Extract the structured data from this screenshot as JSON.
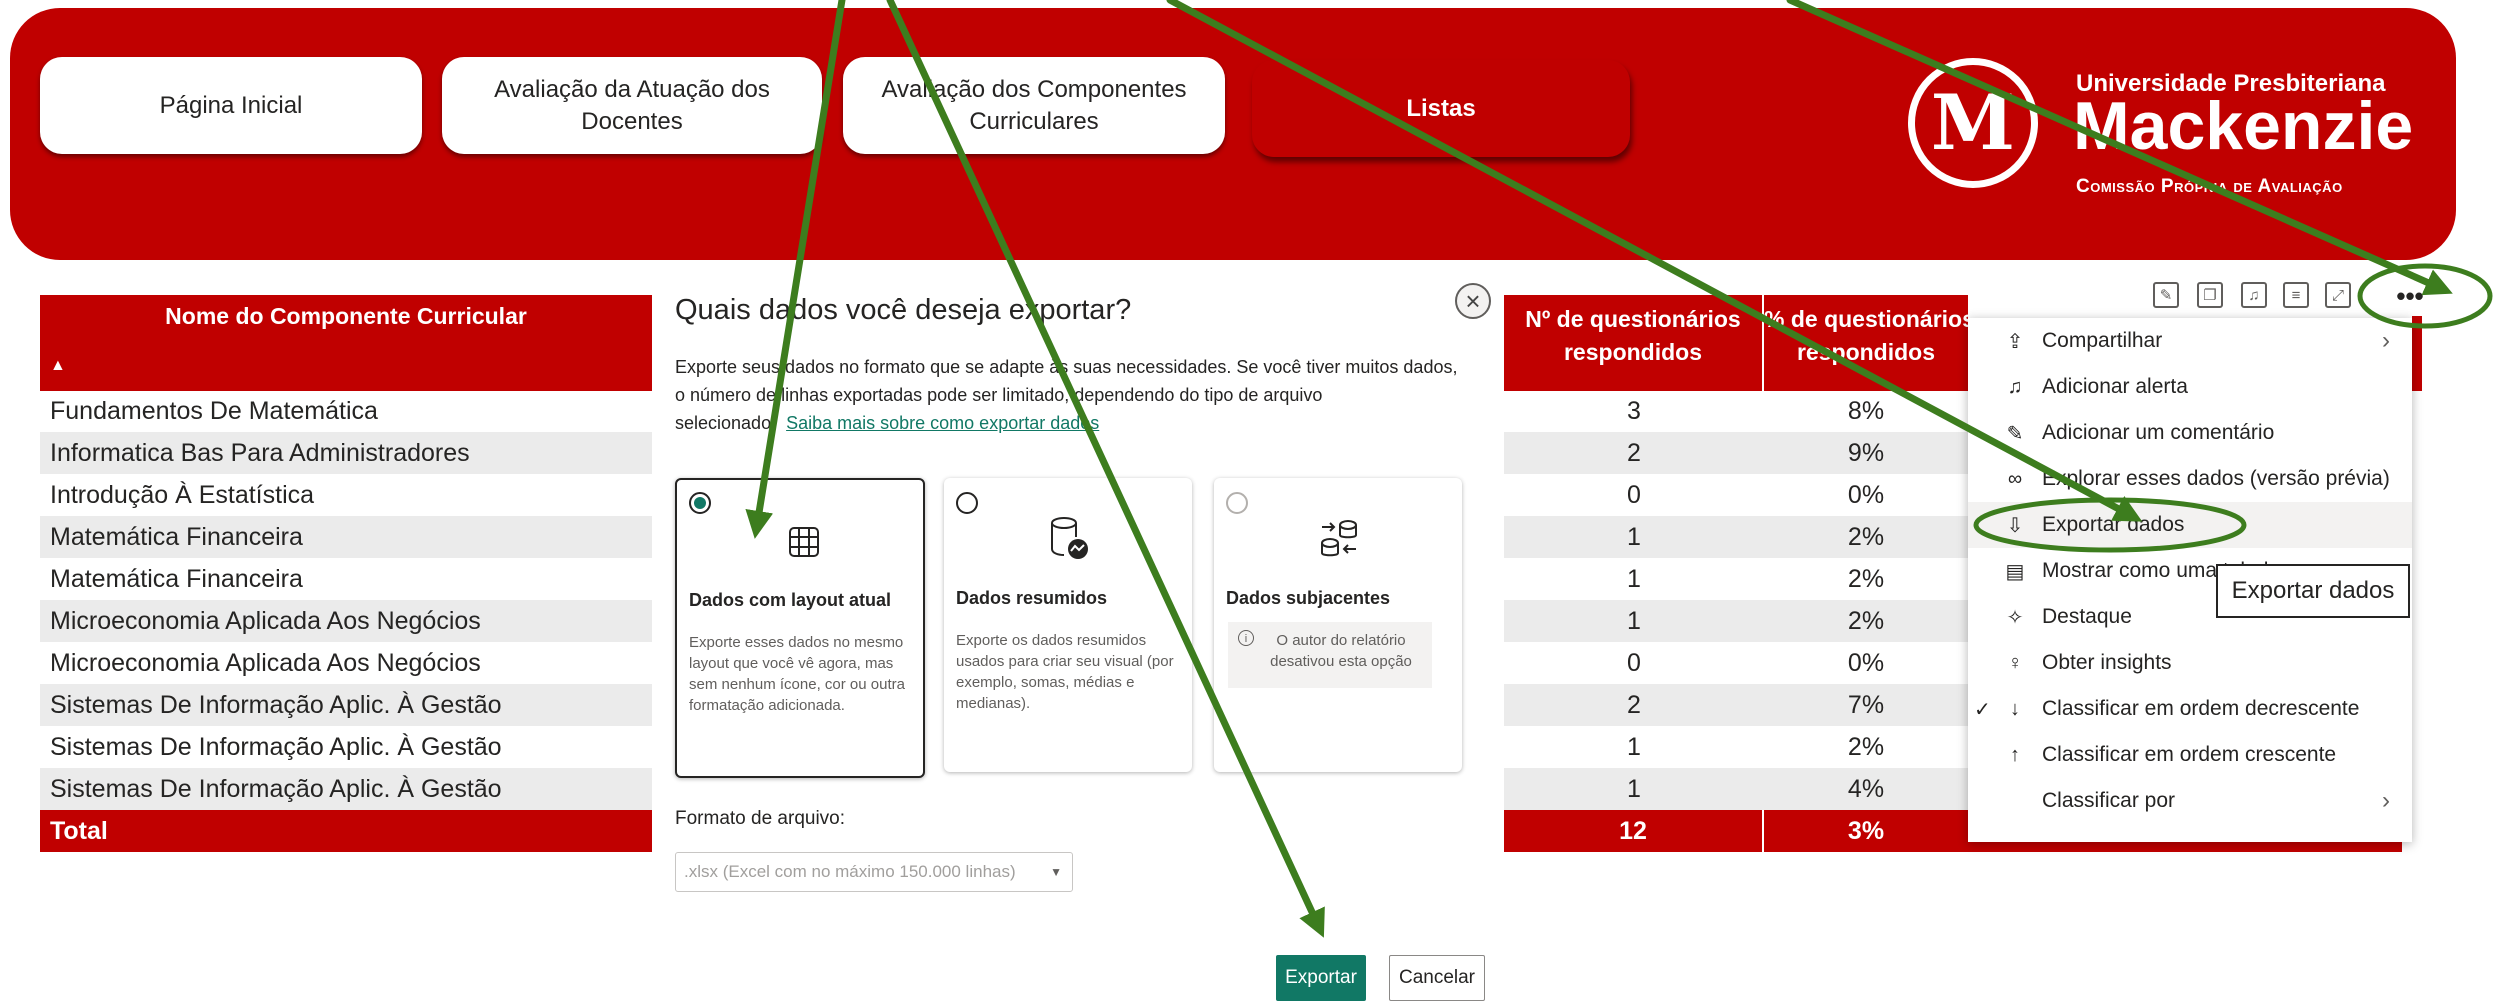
{
  "nav": {
    "home": "Página Inicial",
    "teachers": "Avaliação da Atuação dos Docentes",
    "components_line1": "Avaliação dos Componentes",
    "components_line2": "Curriculares",
    "lists": "Listas"
  },
  "logo": {
    "letter": "M",
    "line1": "Universidade Presbiteriana",
    "line2": "Mackenzie",
    "line3": "Comissão Própria de Avaliação"
  },
  "table": {
    "col_name": "Nome do Componente Curricular",
    "sort_icon": "▲",
    "col_answered_l1": "Nº de questionários",
    "col_answered_l2": "respondidos",
    "col_pct_l1": "% de questionários",
    "col_pct_l2": "respondidos",
    "rows": [
      {
        "name": "Fundamentos De Matemática",
        "answered": "3",
        "pct": "8%"
      },
      {
        "name": "Informatica Bas Para Administradores",
        "answered": "2",
        "pct": "9%"
      },
      {
        "name": "Introdução À Estatística",
        "answered": "0",
        "pct": "0%"
      },
      {
        "name": "Matemática Financeira",
        "answered": "1",
        "pct": "2%"
      },
      {
        "name": "Matemática Financeira",
        "answered": "1",
        "pct": "2%"
      },
      {
        "name": "Microeconomia Aplicada Aos Negócios",
        "answered": "1",
        "pct": "2%"
      },
      {
        "name": "Microeconomia Aplicada Aos Negócios",
        "answered": "0",
        "pct": "0%"
      },
      {
        "name": "Sistemas De Informação Aplic. À Gestão",
        "answered": "2",
        "pct": "7%"
      },
      {
        "name": "Sistemas De Informação Aplic. À Gestão",
        "answered": "1",
        "pct": "2%"
      },
      {
        "name": "Sistemas De Informação Aplic. À Gestão",
        "answered": "1",
        "pct": "4%"
      }
    ],
    "total_label": "Total",
    "total_answered": "12",
    "total_pct": "3%"
  },
  "dialog": {
    "title": "Quais dados você deseja exportar?",
    "desc_line1": "Exporte seus dados no formato que se adapte às suas necessidades. Se você tiver muitos dados,",
    "desc_line2": "o número de linhas exportadas pode ser limitado, dependendo do tipo de arquivo",
    "desc_line3": "selecionado.",
    "learn_more": "Saiba mais sobre como exportar dados",
    "close": "×",
    "cards": [
      {
        "title": "Dados com layout atual",
        "text": "Exporte esses dados no mesmo layout que você vê agora, mas sem nenhum ícone, cor ou outra formatação adicionada.",
        "selected": true
      },
      {
        "title": "Dados resumidos",
        "text": "Exporte os dados resumidos usados para criar seu visual (por exemplo, somas, médias e medianas).",
        "selected": false
      },
      {
        "title": "Dados subjacentes",
        "text": "O autor do relatório desativou esta opção",
        "selected": false,
        "disabled": true
      }
    ],
    "format_label": "Formato de arquivo:",
    "format_value": ".xlsx (Excel com no máximo 150.000 linhas)",
    "export_btn": "Exportar",
    "cancel_btn": "Cancelar"
  },
  "menu": {
    "items": [
      {
        "icon": "share-icon",
        "glyph": "⇪",
        "label": "Compartilhar",
        "submenu": true
      },
      {
        "icon": "bell-icon",
        "glyph": "♫",
        "label": "Adicionar alerta"
      },
      {
        "icon": "comment-icon",
        "glyph": "✎",
        "label": "Adicionar um comentário"
      },
      {
        "icon": "binoculars-icon",
        "glyph": "∞",
        "label": "Explorar esses dados (versão prévia)"
      },
      {
        "icon": "export-icon",
        "glyph": "⇩",
        "label": "Exportar dados"
      },
      {
        "icon": "table-icon",
        "glyph": "▤",
        "label": "Mostrar como uma tabela"
      },
      {
        "icon": "spotlight-icon",
        "glyph": "✧",
        "label": "Destaque"
      },
      {
        "icon": "lightbulb-icon",
        "glyph": "♀",
        "label": "Obter insights"
      },
      {
        "icon": "sort-desc-icon",
        "glyph": "↓",
        "label": "Classificar em ordem decrescente",
        "checked": true
      },
      {
        "icon": "sort-asc-icon",
        "glyph": "↑",
        "label": "Classificar em ordem crescente"
      },
      {
        "icon": "sort-icon",
        "glyph": "",
        "label": "Classificar por",
        "submenu": true
      }
    ],
    "tooltip": "Exportar dados",
    "more_options": "•••"
  },
  "colors": {
    "brand": "#c00000",
    "accent": "#117865",
    "annotation": "#3d7d1e"
  }
}
